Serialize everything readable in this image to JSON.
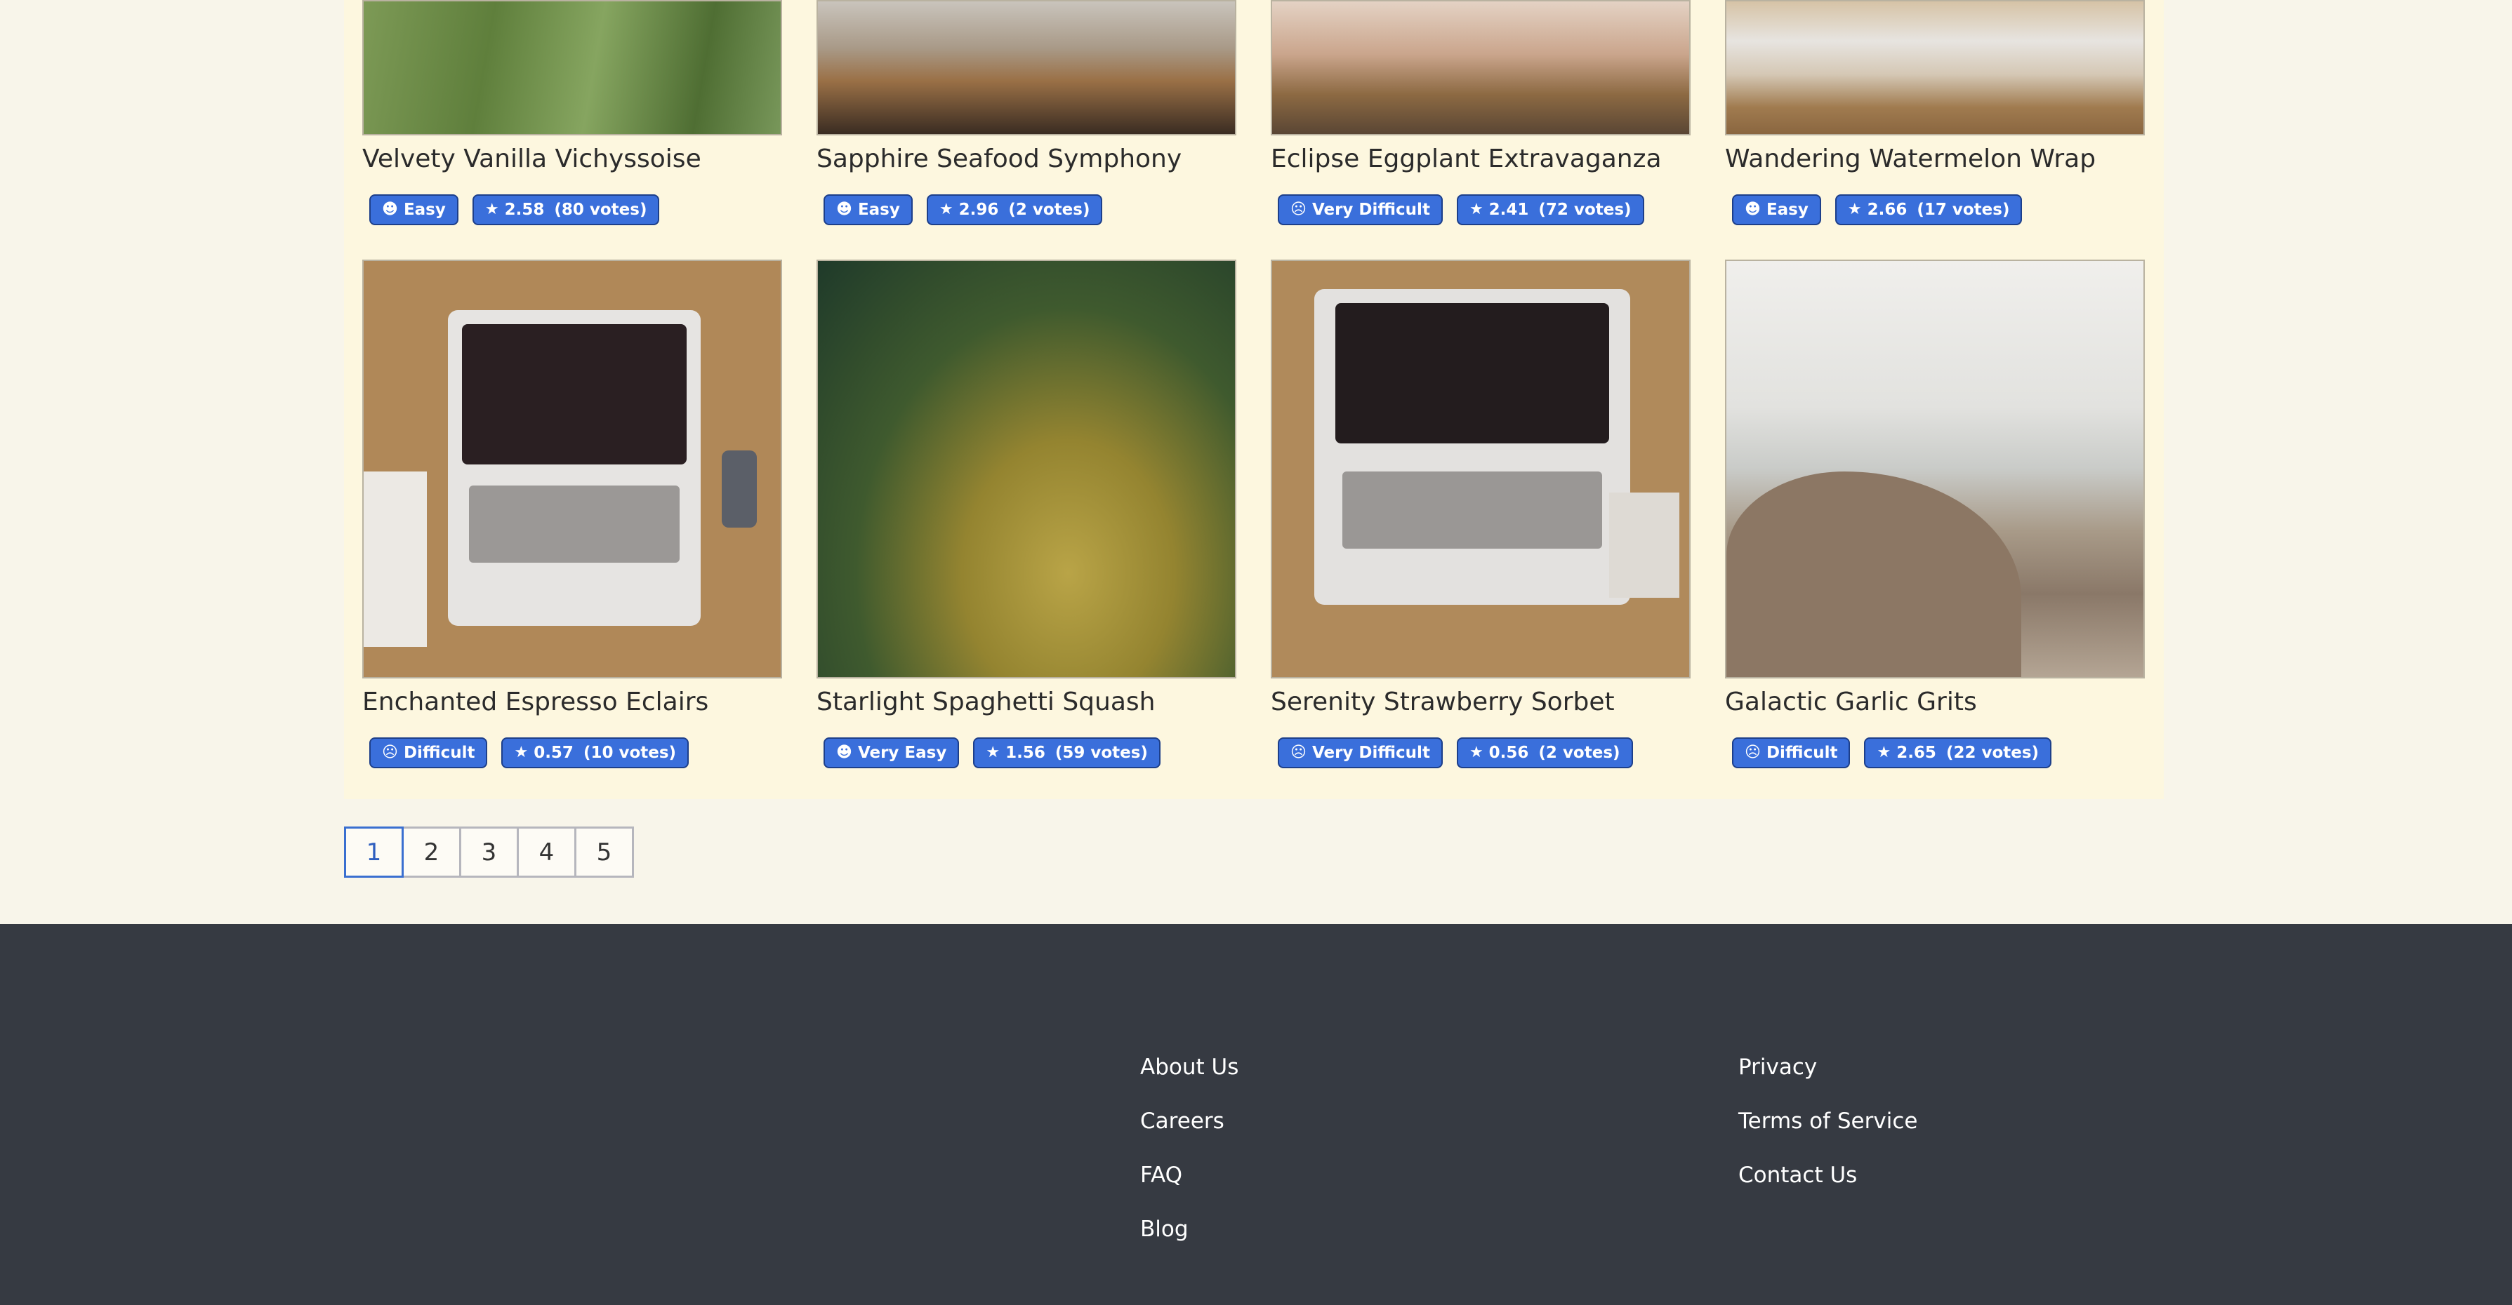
{
  "recipes": [
    {
      "title": "Velvety Vanilla Vichyssoise",
      "difficulty": "Easy",
      "difficulty_icon": "smile-icon",
      "rating": "2.58",
      "votes": "(80 votes)"
    },
    {
      "title": "Sapphire Seafood Symphony",
      "difficulty": "Easy",
      "difficulty_icon": "smile-icon",
      "rating": "2.96",
      "votes": "(2 votes)"
    },
    {
      "title": "Eclipse Eggplant Extravaganza",
      "difficulty": "Very Difficult",
      "difficulty_icon": "dizzy-face-icon",
      "rating": "2.41",
      "votes": "(72 votes)"
    },
    {
      "title": "Wandering Watermelon Wrap",
      "difficulty": "Easy",
      "difficulty_icon": "smile-icon",
      "rating": "2.66",
      "votes": "(17 votes)"
    },
    {
      "title": "Enchanted Espresso Eclairs",
      "difficulty": "Difficult",
      "difficulty_icon": "dizzy-face-icon",
      "rating": "0.57",
      "votes": "(10 votes)"
    },
    {
      "title": "Starlight Spaghetti Squash",
      "difficulty": "Very Easy",
      "difficulty_icon": "smile-icon",
      "rating": "1.56",
      "votes": "(59 votes)"
    },
    {
      "title": "Serenity Strawberry Sorbet",
      "difficulty": "Very Difficult",
      "difficulty_icon": "dizzy-face-icon",
      "rating": "0.56",
      "votes": "(2 votes)"
    },
    {
      "title": "Galactic Garlic Grits",
      "difficulty": "Difficult",
      "difficulty_icon": "dizzy-face-icon",
      "rating": "2.65",
      "votes": "(22 votes)"
    }
  ],
  "pagination": {
    "pages": [
      "1",
      "2",
      "3",
      "4",
      "5"
    ],
    "current": "1"
  },
  "footer": {
    "col1": [
      "About Us",
      "Careers",
      "FAQ",
      "Blog"
    ],
    "col2": [
      "Privacy",
      "Terms of Service",
      "Contact Us"
    ]
  }
}
